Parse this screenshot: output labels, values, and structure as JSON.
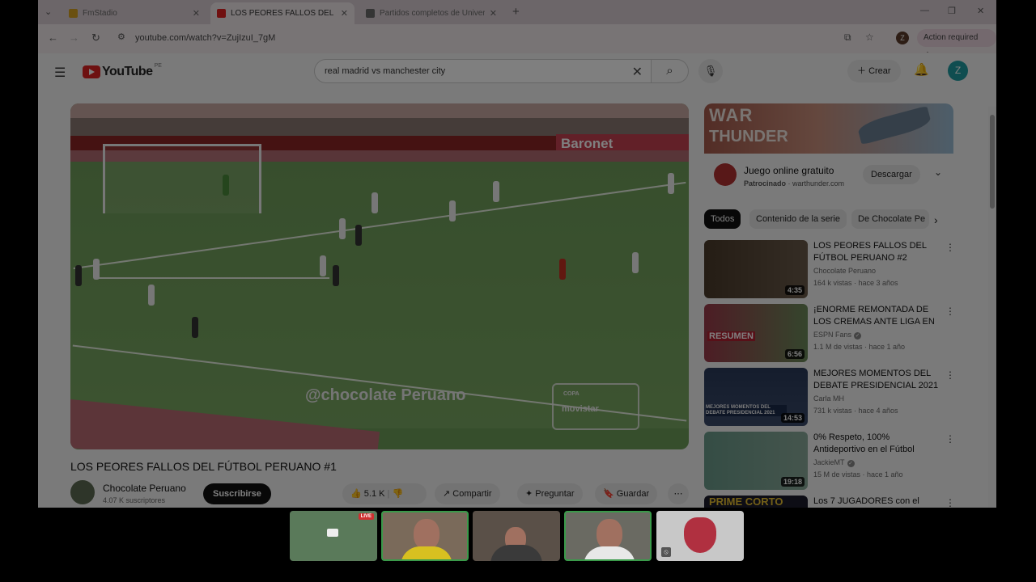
{
  "browser": {
    "tabs": [
      {
        "label": "FmStadio",
        "active": false,
        "favicon_color": "#d4a020"
      },
      {
        "label": "LOS PEORES FALLOS DEL FÚTBOL",
        "active": true,
        "favicon_color": "#e02020"
      },
      {
        "label": "Partidos completos de Universi",
        "active": false,
        "favicon_color": "#6a6a6a"
      }
    ],
    "new_tab": "+",
    "url": "youtube.com/watch?v=ZujIzuI_7gM",
    "action_required": "Action required",
    "profile_initial": "Z"
  },
  "youtube": {
    "logo": "YouTube",
    "region": "PE",
    "search_query": "real madrid vs manchester city",
    "create_label": "Crear",
    "avatar_initial": "Z",
    "video": {
      "watermark": "@chocolate Peruano",
      "ad_board": "Baronet",
      "copa_label": "COPA",
      "copa_brand": "movistar",
      "title": "LOS PEORES FALLOS DEL FÚTBOL PERUANO #1",
      "channel": "Chocolate Peruano",
      "subscribers": "4.07 K suscriptores",
      "subscribe_label": "Suscribirse",
      "likes": "5.1 K",
      "share_label": "Compartir",
      "ask_label": "Preguntar",
      "save_label": "Guardar"
    },
    "ad": {
      "banner_line1": "WAR",
      "banner_line2": "THUNDER",
      "title": "Juego online gratuito",
      "sponsored": "Patrocinado",
      "domain": "warthunder.com",
      "download_label": "Descargar"
    },
    "chips": [
      "Todos",
      "Contenido de la serie",
      "De Chocolate Pe"
    ],
    "recommendations": [
      {
        "title": "LOS PEORES FALLOS DEL FÚTBOL PERUANO #2",
        "channel": "Chocolate Peruano",
        "verified": false,
        "meta": "164 k vistas · hace 3 años",
        "duration": "4:35",
        "thumb_color": "#5a4a3a"
      },
      {
        "title": "¡ENORME REMONTADA DE LOS CREMAS ANTE LIGA EN EL ...",
        "channel": "ESPN Fans",
        "verified": true,
        "meta": "1.1 M de vistas · hace 1 año",
        "duration": "6:56",
        "thumb_color": "#6a8a5a",
        "thumb_text": "RESUMEN"
      },
      {
        "title": "MEJORES MOMENTOS DEL DEBATE PRESIDENCIAL 2021 ...",
        "channel": "Carla MH",
        "verified": false,
        "meta": "731 k vistas · hace 4 años",
        "duration": "14:53",
        "thumb_color": "#3a4a6a",
        "thumb_text": "MEJORES MOMENTOS DEL DEBATE PRESIDENCIAL 2021"
      },
      {
        "title": "0% Respeto, 100% Antideportivo en el Fútbol",
        "channel": "JackieMT",
        "verified": true,
        "meta": "15 M de vistas · hace 1 año",
        "duration": "19:18",
        "thumb_color": "#7a9a8a"
      },
      {
        "title": "Los 7 JUGADORES con el",
        "channel": "",
        "verified": false,
        "meta": "",
        "duration": "",
        "thumb_color": "#1a1a2a",
        "thumb_text": "PRIME CORTO"
      }
    ]
  },
  "meeting": {
    "live_badge": "LIVE",
    "participants": [
      {
        "name": "screen-share",
        "speaking": false
      },
      {
        "name": "participant-yellow",
        "speaking": true,
        "shirt_color": "#d8c020"
      },
      {
        "name": "participant-dark",
        "speaking": false,
        "shirt_color": "#3a3a3a"
      },
      {
        "name": "participant-white",
        "speaking": true,
        "shirt_color": "#e8e8e8"
      },
      {
        "name": "participant-avatar",
        "speaking": false
      }
    ]
  }
}
